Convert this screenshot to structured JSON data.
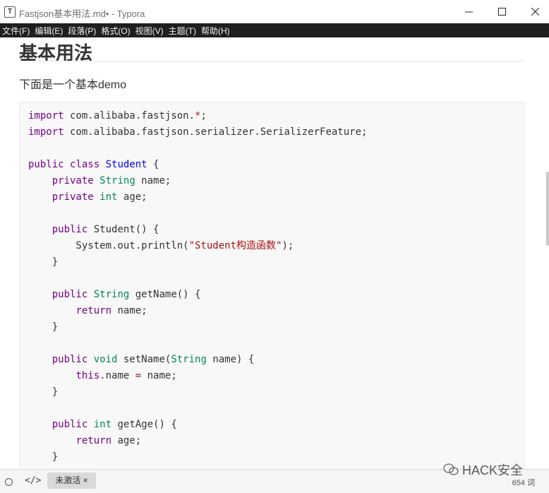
{
  "window": {
    "app_icon": "T",
    "title": "Fastjson基本用法.md• - Typora"
  },
  "menu": [
    "文件(F)",
    "编辑(E)",
    "段落(P)",
    "格式(O)",
    "视图(V)",
    "主题(T)",
    "帮助(H)"
  ],
  "doc": {
    "heading": "基本用法",
    "paragraph": "下面是一个基本demo",
    "code_lines": [
      [
        {
          "t": "import",
          "c": "kw"
        },
        {
          "t": " com.alibaba.fastjson."
        },
        {
          "t": "*",
          "c": "op"
        },
        {
          "t": ";"
        }
      ],
      [
        {
          "t": "import",
          "c": "kw"
        },
        {
          "t": " com.alibaba.fastjson.serializer.SerializerFeature;"
        }
      ],
      [],
      [
        {
          "t": "public",
          "c": "kw"
        },
        {
          "t": " "
        },
        {
          "t": "class",
          "c": "kw"
        },
        {
          "t": " "
        },
        {
          "t": "Student",
          "c": "cls"
        },
        {
          "t": " {"
        }
      ],
      [
        {
          "t": "    "
        },
        {
          "t": "private",
          "c": "kw"
        },
        {
          "t": " "
        },
        {
          "t": "String",
          "c": "ty"
        },
        {
          "t": " name;"
        }
      ],
      [
        {
          "t": "    "
        },
        {
          "t": "private",
          "c": "kw"
        },
        {
          "t": " "
        },
        {
          "t": "int",
          "c": "ty"
        },
        {
          "t": " age;"
        }
      ],
      [],
      [
        {
          "t": "    "
        },
        {
          "t": "public",
          "c": "kw"
        },
        {
          "t": " Student() {"
        }
      ],
      [
        {
          "t": "        System.out.println("
        },
        {
          "t": "\"Student构造函数\"",
          "c": "st"
        },
        {
          "t": ");"
        }
      ],
      [
        {
          "t": "    }"
        }
      ],
      [],
      [
        {
          "t": "    "
        },
        {
          "t": "public",
          "c": "kw"
        },
        {
          "t": " "
        },
        {
          "t": "String",
          "c": "ty"
        },
        {
          "t": " getName() {"
        }
      ],
      [
        {
          "t": "        "
        },
        {
          "t": "return",
          "c": "kw"
        },
        {
          "t": " name;"
        }
      ],
      [
        {
          "t": "    }"
        }
      ],
      [],
      [
        {
          "t": "    "
        },
        {
          "t": "public",
          "c": "kw"
        },
        {
          "t": " "
        },
        {
          "t": "void",
          "c": "ty"
        },
        {
          "t": " setName("
        },
        {
          "t": "String",
          "c": "ty"
        },
        {
          "t": " name) {"
        }
      ],
      [
        {
          "t": "        "
        },
        {
          "t": "this",
          "c": "kw"
        },
        {
          "t": ".name "
        },
        {
          "t": "=",
          "c": "op"
        },
        {
          "t": " name;"
        }
      ],
      [
        {
          "t": "    }"
        }
      ],
      [],
      [
        {
          "t": "    "
        },
        {
          "t": "public",
          "c": "kw"
        },
        {
          "t": " "
        },
        {
          "t": "int",
          "c": "ty"
        },
        {
          "t": " getAge() {"
        }
      ],
      [
        {
          "t": "        "
        },
        {
          "t": "return",
          "c": "kw"
        },
        {
          "t": " age;"
        }
      ],
      [
        {
          "t": "    }"
        }
      ]
    ]
  },
  "footer": {
    "source_mode_label": "</>",
    "tab_label": "未激活 ×",
    "watermark": "HACK安全",
    "word_count": "654 词"
  }
}
